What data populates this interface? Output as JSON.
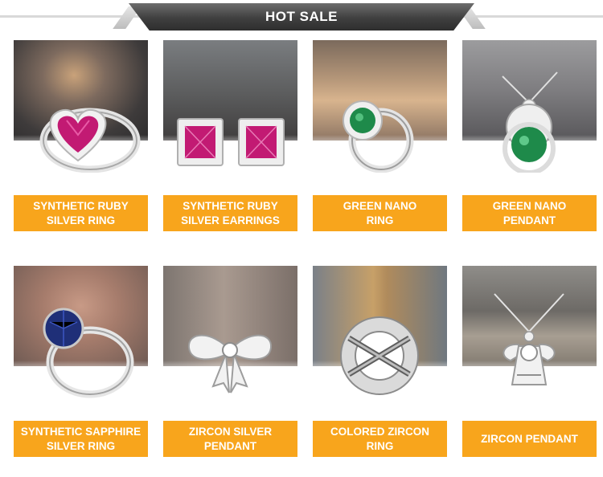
{
  "header": {
    "title": "HOT SALE"
  },
  "colors": {
    "accent": "#f8a51c",
    "banner": "#3f3f3f",
    "ruby": "#c21a73",
    "emerald": "#1e8a4a",
    "sapphire": "#1f2f78",
    "silver": "#dcdcdc"
  },
  "products": [
    {
      "label": "SYNTHETIC RUBY\nSILVER RING",
      "icon": "ruby-heart-ring-icon"
    },
    {
      "label": "SYNTHETIC RUBY\nSILVER EARRINGS",
      "icon": "ruby-square-earrings-icon"
    },
    {
      "label": "GREEN NANO\nRING",
      "icon": "green-nano-ring-icon"
    },
    {
      "label": "GREEN NANO\nPENDANT",
      "icon": "green-nano-pendant-icon"
    },
    {
      "label": "SYNTHETIC SAPPHIRE\nSILVER RING",
      "icon": "sapphire-ring-icon"
    },
    {
      "label": "ZIRCON SILVER\nPENDANT",
      "icon": "zircon-bow-pendant-icon"
    },
    {
      "label": "COLORED ZIRCON\nRING",
      "icon": "colored-zircon-ring-icon"
    },
    {
      "label": "ZIRCON PENDANT",
      "icon": "zircon-angel-pendant-icon"
    }
  ]
}
